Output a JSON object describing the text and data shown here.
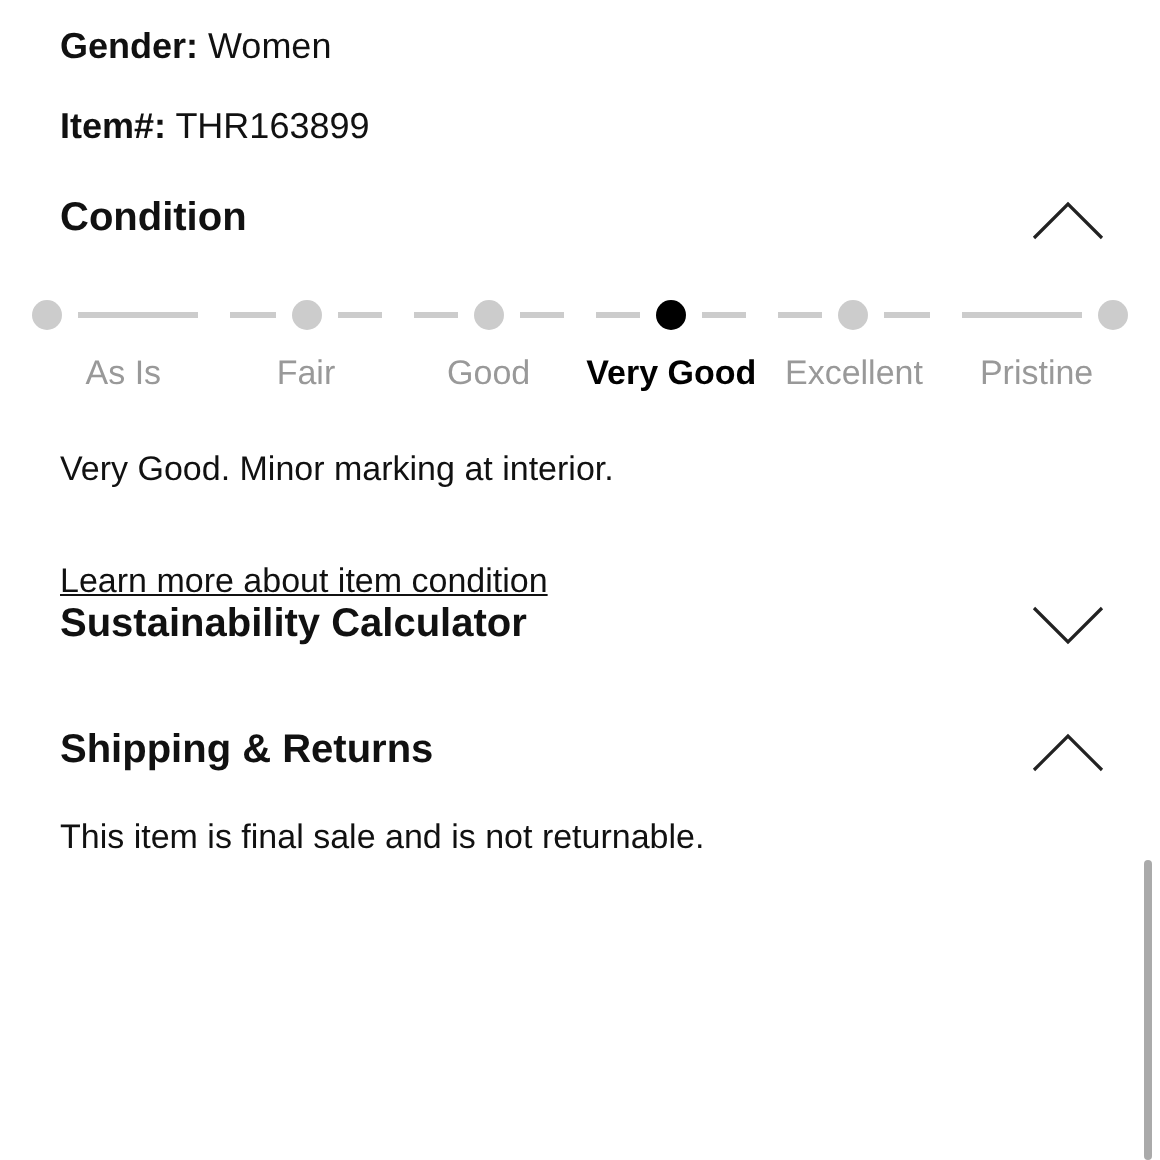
{
  "details": [
    {
      "label": "Gender:",
      "value": "Women"
    },
    {
      "label": "Item#:",
      "value": "THR163899"
    }
  ],
  "condition": {
    "title": "Condition",
    "expanded": true,
    "steps": [
      {
        "label": "As Is",
        "selected": false
      },
      {
        "label": "Fair",
        "selected": false
      },
      {
        "label": "Good",
        "selected": false
      },
      {
        "label": "Very Good",
        "selected": true
      },
      {
        "label": "Excellent",
        "selected": false
      },
      {
        "label": "Pristine",
        "selected": false
      }
    ],
    "description": "Very Good. Minor marking at interior.",
    "link": "Learn more about item condition"
  },
  "sections": [
    {
      "title": "Sustainability Calculator",
      "expanded": false
    },
    {
      "title": "Shipping & Returns",
      "expanded": true,
      "body": "This item is final sale and is not returnable."
    }
  ]
}
